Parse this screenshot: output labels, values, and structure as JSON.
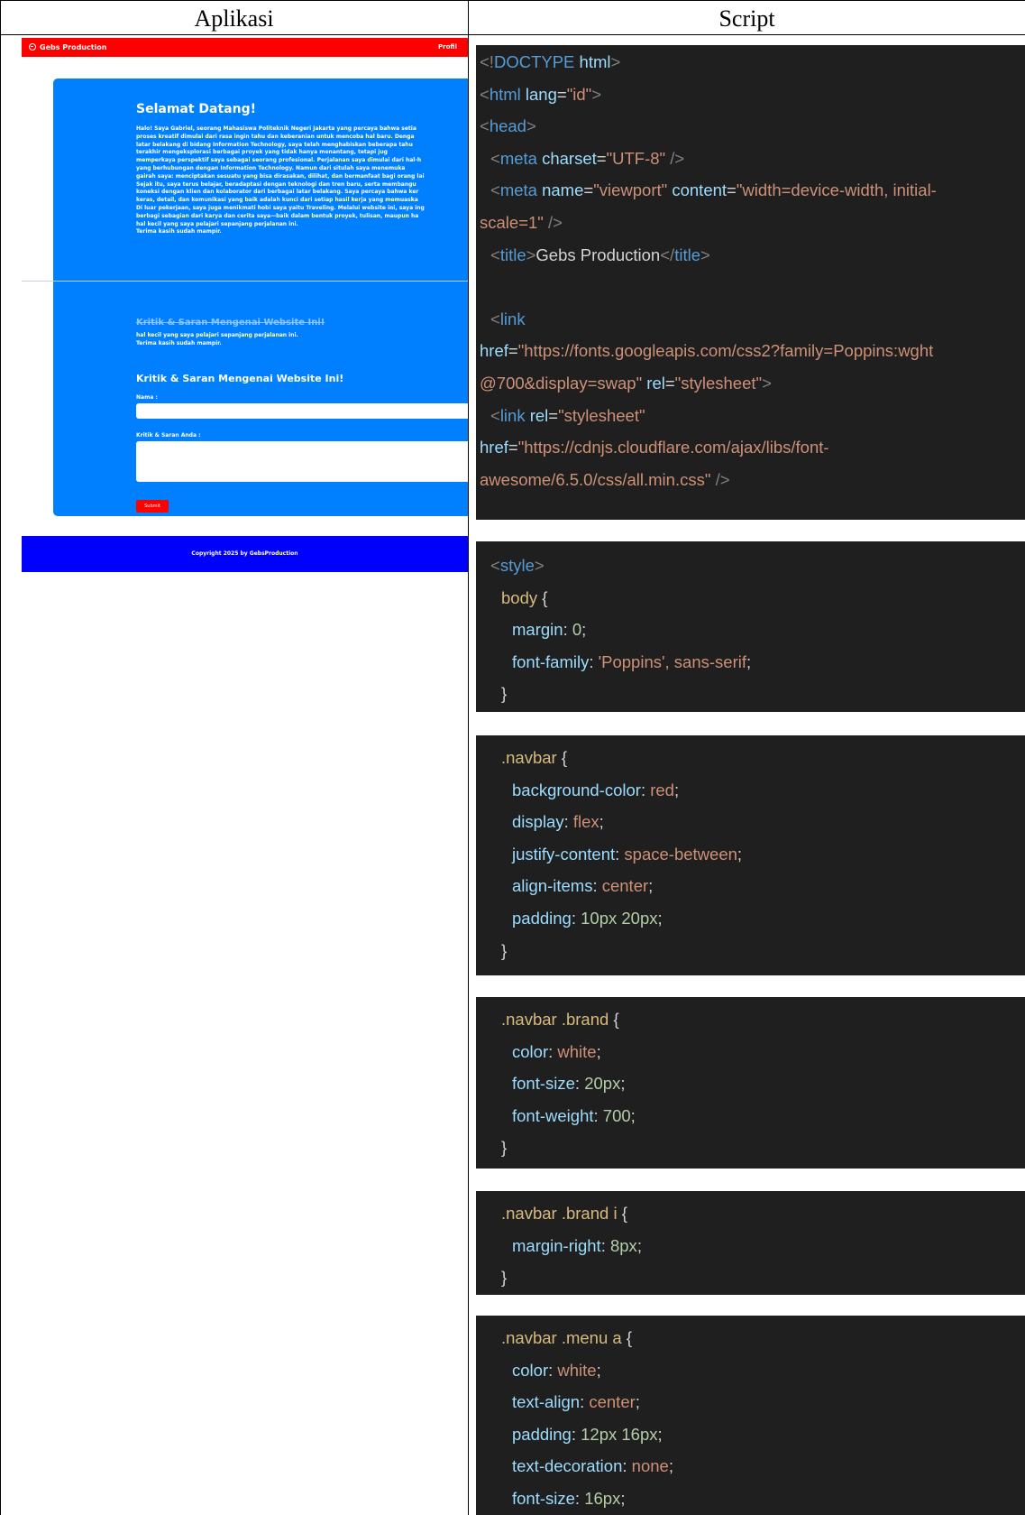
{
  "table": {
    "header_left": "Aplikasi",
    "header_right": "Script"
  },
  "app": {
    "brand": "Gebs Production",
    "menu_link": "Profil",
    "welcome_title": "Selamat Datang!",
    "about_lines": [
      "Halo! Saya Gabriel, seorang Mahasiswa Politeknik Negeri Jakarta yang percaya bahwa setia",
      "proses kreatif dimulai dari rasa ingin tahu dan keberanian untuk mencoba hal baru. Denga",
      "latar belakang di bidang Information Technology, saya telah menghabiskan beberapa tahu",
      "terakhir mengeksplorasi berbagai proyek yang tidak hanya menantang, tetapi jug",
      "memperkaya perspektif saya sebagai seorang profesional. Perjalanan saya dimulai dari hal-h",
      "yang berhubungan dengan Information Technology. Namun dari situlah saya menemuka",
      "gairah saya: menciptakan sesuatu yang bisa dirasakan, dilihat, dan bermanfaat bagi orang lai",
      "Sejak itu, saya terus belajar, beradaptasi dengan teknologi dan tren baru, serta membangu",
      "koneksi dengan klien dan kolaborator dari berbagai latar belakang. Saya percaya bahwa ker",
      "keras, detail, dan komunikasi yang baik adalah kunci dari setiap hasil kerja yang memuaska",
      "Di luar pekerjaan, saya juga menikmati hobi saya yaitu Traveling. Melalui website ini, saya ing",
      "berbagi sebagian dari karya dan cerita saya—baik dalam bentuk proyek, tulisan, maupun ha",
      "hal kecil yang saya pelajari sepanjang perjalanan ini."
    ],
    "closing": "Terima kasih sudah mampir.",
    "ghost_title": "Kritik & Saran Mengenai Website Ini!",
    "ghost_line_1": "hal kecil yang saya pelajari sepanjang perjalanan ini.",
    "ghost_line_2": "Terima kasih sudah mampir.",
    "form_title": "Kritik & Saran Mengenai Website Ini!",
    "name_label": "Nama :",
    "message_label": "Kritik & Saran Anda :",
    "submit_label": "Submit",
    "footer": "Copyright 2025 by GebsProduction"
  },
  "code": {
    "doctype": "<!DOCTYPE html>",
    "html_tag": "<html lang=\"id\">",
    "head_tag": "<head>",
    "meta_charset": "<meta charset=\"UTF-8\" />",
    "meta_viewport_1": "<meta name=\"viewport\" content=\"width=device-width, initial-",
    "meta_viewport_2": "scale=1\" />",
    "title_tag": "<title>Gebs Production</title>",
    "link_open": "<link",
    "font_href_1": "href=\"https://fonts.googleapis.com/css2?family=Poppins:wght",
    "font_href_2": "@700&display=swap\" rel=\"stylesheet\">",
    "fa_link": "<link rel=\"stylesheet\"",
    "fa_href_1": "href=\"https://cdnjs.cloudflare.com/ajax/libs/font-",
    "fa_href_2": "awesome/6.5.0/css/all.min.css\" />",
    "style_open": "<style>",
    "body_sel": "body {",
    "body_margin": "margin: 0;",
    "body_font": "font-family: 'Poppins', sans-serif;",
    "close_brace": "}",
    "navbar_sel": ".navbar {",
    "navbar_bg": "background-color: red;",
    "navbar_display": "display: flex;",
    "navbar_justify": "justify-content: space-between;",
    "navbar_align": "align-items: center;",
    "navbar_padding": "padding: 10px 20px;",
    "brand_sel": ".navbar .brand {",
    "brand_color": "color: white;",
    "brand_size": "font-size: 20px;",
    "brand_weight": "font-weight: 700;",
    "brand_i_sel": ".navbar .brand i {",
    "brand_i_margin": "margin-right: 8px;",
    "menu_a_sel": ".navbar .menu a {",
    "menu_a_color": "color: white;",
    "menu_a_align": "text-align: center;",
    "menu_a_padding": "padding: 12px 16px;",
    "menu_a_deco": "text-decoration: none;",
    "menu_a_size": "font-size: 16px;"
  }
}
